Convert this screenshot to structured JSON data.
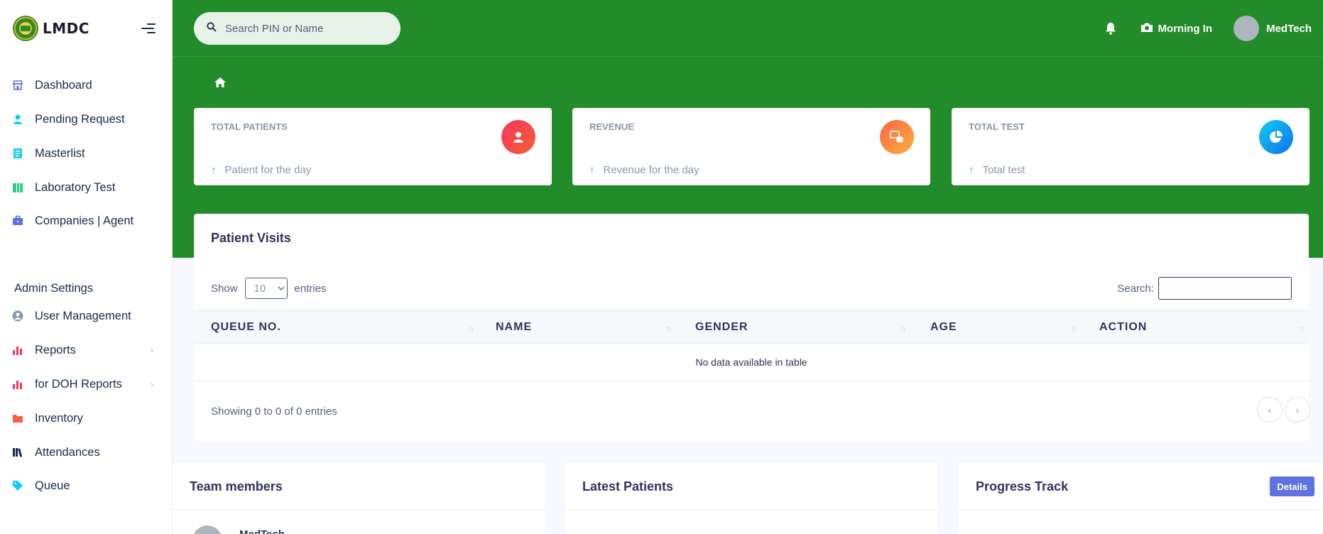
{
  "sidebar": {
    "brand": "LMDC",
    "items": [
      {
        "label": "Dashboard",
        "icon": "store-icon",
        "color": "#5e72e4"
      },
      {
        "label": "Pending Request",
        "icon": "user-icon",
        "color": "#11cdef"
      },
      {
        "label": "Masterlist",
        "icon": "list-icon",
        "color": "#11cdef"
      },
      {
        "label": "Laboratory Test",
        "icon": "flask-icon",
        "color": "#2dce89"
      },
      {
        "label": "Companies | Agent",
        "icon": "briefcase-icon",
        "color": "#5e72e4"
      }
    ],
    "admin_title": "Admin Settings",
    "admin_items": [
      {
        "label": "User Management",
        "icon": "user-circle-icon",
        "color": "#8898aa"
      },
      {
        "label": "Reports",
        "icon": "bar-chart-icon",
        "color": "#f5365c"
      },
      {
        "label": "for DOH Reports",
        "icon": "bar-chart-icon",
        "color": "#f5365c"
      },
      {
        "label": "Inventory",
        "icon": "folder-icon",
        "color": "#fb6340"
      },
      {
        "label": "Attendances",
        "icon": "books-icon",
        "color": "#172b4d"
      },
      {
        "label": "Queue",
        "icon": "tag-icon",
        "color": "#11cdef"
      }
    ]
  },
  "topbar": {
    "search_placeholder": "Search PIN or Name",
    "time_in_label": "Morning In",
    "user_name": "MedTech"
  },
  "stats": [
    {
      "title": "TOTAL PATIENTS",
      "subtitle": "Patient for the day",
      "icon": "user-icon",
      "color": "#f5365c"
    },
    {
      "title": "REVENUE",
      "subtitle": "Revenue for the day",
      "icon": "money-icon",
      "color": "#fb6340"
    },
    {
      "title": "TOTAL TEST",
      "subtitle": "Total test",
      "icon": "pie-chart-icon",
      "color": "#11cdef"
    }
  ],
  "visits": {
    "title": "Patient Visits",
    "show_label": "Show",
    "entries_value": "10",
    "entries_label": "entries",
    "search_label": "Search:",
    "columns": [
      "QUEUE NO.",
      "NAME",
      "GENDER",
      "AGE",
      "ACTION"
    ],
    "empty_text": "No data available in table",
    "info": "Showing 0 to 0 of 0 entries"
  },
  "bottom": {
    "team_title": "Team members",
    "member_name": "MedTech",
    "latest_title": "Latest Patients",
    "progress_title": "Progress Track",
    "details_label": "Details"
  },
  "colors": {
    "band": "#228b2a",
    "accent": "#5e72e4"
  }
}
